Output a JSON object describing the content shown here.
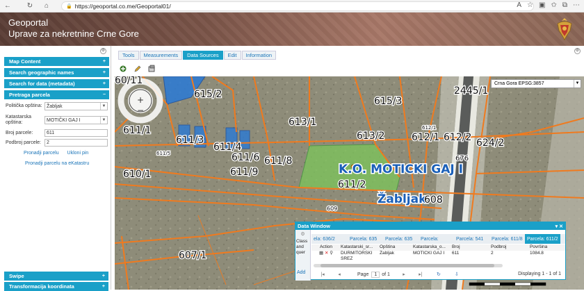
{
  "browser": {
    "url": "https://geoportal.co.me/Geoportal01/"
  },
  "header": {
    "line1": "Geoportal",
    "line2": "Uprave za nekretnine Crne Gore"
  },
  "left_panel": {
    "sections": [
      {
        "label": "Map Content",
        "sign": "+"
      },
      {
        "label": "Search geographic names",
        "sign": "+"
      },
      {
        "label": "Search for data (metadata)",
        "sign": "+"
      },
      {
        "label": "Pretraga parcela",
        "sign": "−"
      }
    ],
    "politicka_label": "Politička opština:",
    "politicka_value": "Žabljak",
    "katastarska_label": "Katastarska opština:",
    "katastarska_value": "MOTIČKI GAJ I",
    "broj_label": "Broj parcele:",
    "broj_value": "611",
    "podbroj_label": "Podbroj parcele:",
    "podbroj_value": "2",
    "link_find": "Pronadji parcelu",
    "link_remove": "Ukloni pin",
    "link_ekatastar": "Pronadji parcelu na eKatastru",
    "bottom_sections": [
      {
        "label": "Swipe",
        "sign": "+"
      },
      {
        "label": "Transformacija koordinata",
        "sign": "+"
      }
    ]
  },
  "tabs": [
    "Tools",
    "Measurements",
    "Data Sources",
    "Edit",
    "Information"
  ],
  "active_tab": "Data Sources",
  "projection": "Crna Gora EPSG:3857",
  "map": {
    "labels": [
      "615/2",
      "615/3",
      "2445/1",
      "611/1",
      "613/1",
      "613/2",
      "612/1",
      "612/2",
      "624/2",
      "611/3",
      "611/4",
      "611/6",
      "611/8",
      "676",
      "610/1",
      "611/9",
      "611/2",
      "K.O. MOTICKI GAJ I",
      "Žabljak",
      "608",
      "609",
      "607/1",
      "60/11"
    ],
    "small_labels": [
      "611/5",
      "612/1"
    ]
  },
  "data_window": {
    "title": "Data Window",
    "side_text": "Class and quer",
    "add": "Add",
    "tabs": [
      "ela: 636/2",
      "Parcela: 635",
      "Parcela: 635",
      "Parcela:",
      "Parcela: 541",
      "Parcela: 611/8",
      "Parcela: 611/2"
    ],
    "columns": [
      "Action",
      "Katastarski_sr...",
      "Opština",
      "Katastarska_o...",
      "Broj",
      "Podbroj",
      "Površina"
    ],
    "row": {
      "katastarski": "DURMITORSKI SREZ",
      "opstina": "Žabljak",
      "katastarska": "MOTIČKI GAJ I",
      "broj": "611",
      "podbroj": "2",
      "povrsina": "1084.8"
    },
    "page_label": "Page",
    "page_num": "1",
    "page_of": "of 1",
    "displaying": "Displaying 1 - 1 of 1"
  },
  "colors": {
    "accent": "#1aa0c8",
    "parcel_line": "#f07a1e",
    "highlight": "#7cc65a"
  }
}
